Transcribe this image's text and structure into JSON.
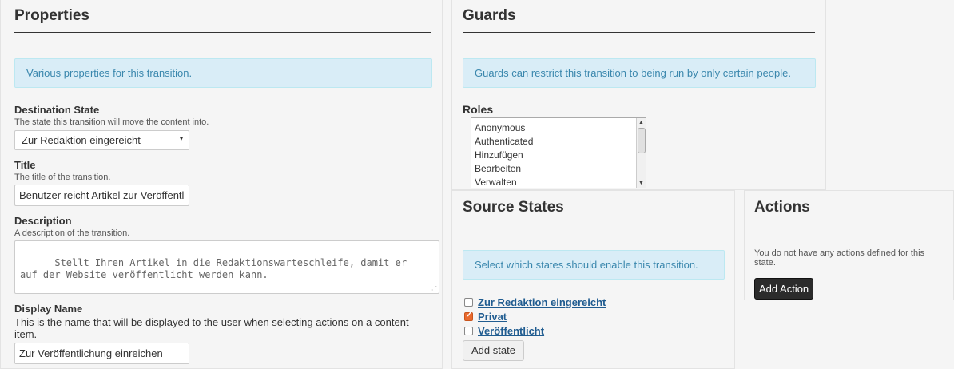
{
  "properties": {
    "title": "Properties",
    "info": "Various properties for this transition.",
    "destination": {
      "label": "Destination State",
      "help": "The state this transition will move the content into.",
      "selected": "Zur Redaktion eingereicht"
    },
    "title_field": {
      "label": "Title",
      "help": "The title of the transition.",
      "value": "Benutzer reicht Artikel zur Veröffentl"
    },
    "description": {
      "label": "Description",
      "help": "A description of the transition.",
      "value": "Stellt Ihren Artikel in die Redaktionswarteschleife, damit er\nauf der Website veröffentlicht werden kann."
    },
    "display_name": {
      "label": "Display Name",
      "help": "This is the name that will be displayed to the user when selecting actions on a content item.",
      "value": "Zur Veröffentlichung einreichen"
    }
  },
  "guards": {
    "title": "Guards",
    "info": "Guards can restrict this transition to being run by only certain people.",
    "roles_label": "Roles",
    "roles": [
      "Anonymous",
      "Authenticated",
      "Hinzufügen",
      "Bearbeiten",
      "Verwalten"
    ]
  },
  "source_states": {
    "title": "Source States",
    "info": "Select which states should enable this transition.",
    "states": [
      {
        "label": "Zur Redaktion eingereicht",
        "checked": false
      },
      {
        "label": "Privat",
        "checked": true
      },
      {
        "label": "Veröffentlicht",
        "checked": false
      }
    ],
    "add_label": "Add state"
  },
  "actions": {
    "title": "Actions",
    "empty": "You do not have any actions defined for this state.",
    "add_label": "Add Action"
  }
}
